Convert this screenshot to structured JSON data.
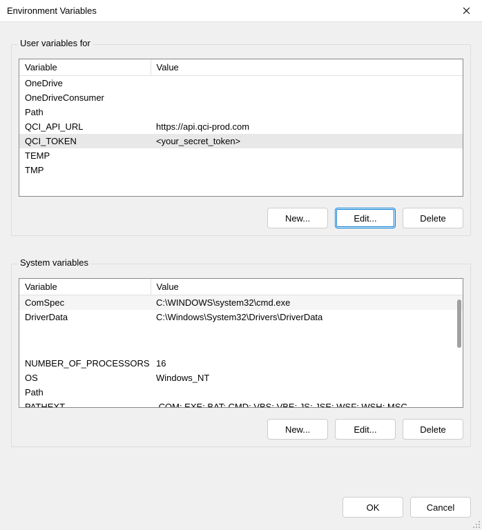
{
  "title": "Environment Variables",
  "user_group": {
    "label": "User variables for",
    "columns": {
      "variable": "Variable",
      "value": "Value"
    },
    "rows": [
      {
        "variable": "OneDrive",
        "value": ""
      },
      {
        "variable": "OneDriveConsumer",
        "value": ""
      },
      {
        "variable": "Path",
        "value": ""
      },
      {
        "variable": "QCI_API_URL",
        "value": "https://api.qci-prod.com"
      },
      {
        "variable": "QCI_TOKEN",
        "value": "<your_secret_token>",
        "selected": true
      },
      {
        "variable": "TEMP",
        "value": ""
      },
      {
        "variable": "TMP",
        "value": ""
      }
    ],
    "buttons": {
      "new": "New...",
      "edit": "Edit...",
      "delete": "Delete"
    }
  },
  "system_group": {
    "label": "System variables",
    "columns": {
      "variable": "Variable",
      "value": "Value"
    },
    "rows": [
      {
        "variable": "ComSpec",
        "value": "C:\\WINDOWS\\system32\\cmd.exe",
        "hl": true
      },
      {
        "variable": "DriverData",
        "value": "C:\\Windows\\System32\\Drivers\\DriverData"
      },
      {
        "variable": "NUMBER_OF_PROCESSORS",
        "value": "16"
      },
      {
        "variable": "OS",
        "value": "Windows_NT"
      },
      {
        "variable": "Path",
        "value": ""
      },
      {
        "variable": "PATHEXT",
        "value": ".COM;.EXE;.BAT;.CMD;.VBS;.VBE;.JS;.JSE;.WSF;.WSH;.MSC"
      }
    ],
    "buttons": {
      "new": "New...",
      "edit": "Edit...",
      "delete": "Delete"
    }
  },
  "footer": {
    "ok": "OK",
    "cancel": "Cancel"
  }
}
